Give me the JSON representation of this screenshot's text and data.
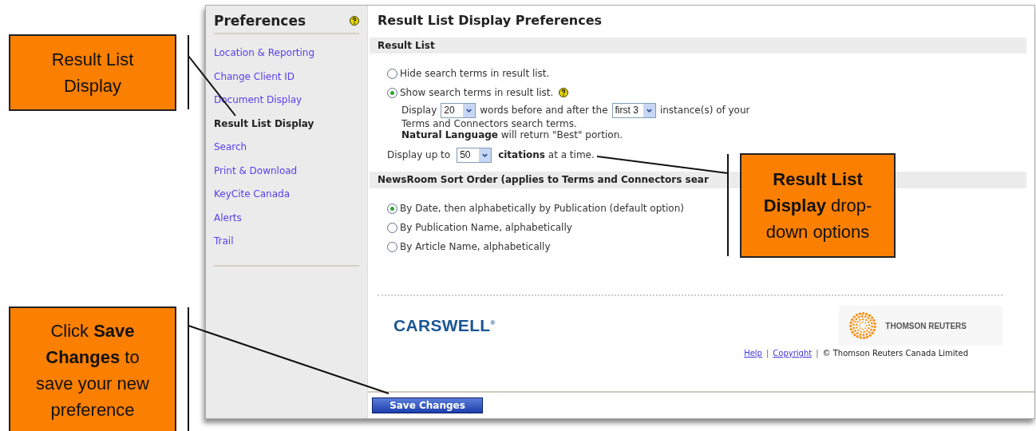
{
  "sidebar": {
    "title": "Preferences",
    "help": true,
    "items": [
      {
        "label": "Location & Reporting",
        "selected": false
      },
      {
        "label": "Change Client ID",
        "selected": false
      },
      {
        "label": "Document Display",
        "selected": false
      },
      {
        "label": "Result List Display",
        "selected": true
      },
      {
        "label": "Search",
        "selected": false
      },
      {
        "label": "Print & Download",
        "selected": false
      },
      {
        "label": "KeyCite Canada",
        "selected": false
      },
      {
        "label": "Alerts",
        "selected": false
      },
      {
        "label": "Trail",
        "selected": false
      }
    ]
  },
  "main": {
    "title": "Result List Display Preferences",
    "result_list": {
      "heading": "Result List",
      "options": [
        {
          "label": "Hide search terms in result list.",
          "selected": false,
          "help": false
        },
        {
          "label": "Show search terms in result list.",
          "selected": true,
          "help": true
        }
      ],
      "words_row": [
        {
          "kind": "text",
          "text": "Display"
        },
        {
          "kind": "select",
          "value": "20"
        },
        {
          "kind": "text",
          "text": "words before and after the"
        },
        {
          "kind": "select",
          "value": "first 3"
        },
        {
          "kind": "text",
          "text": "instance(s) of your"
        }
      ],
      "notes": [
        "Terms and Connectors search terms.",
        "**Natural Language** will return \"Best\" portion."
      ],
      "citations_row": [
        {
          "kind": "text",
          "text": "Display up to"
        },
        {
          "kind": "select",
          "value": "50"
        },
        {
          "kind": "text",
          "text": "**citations** at a time."
        }
      ]
    },
    "sort_order": {
      "heading": "NewsRoom Sort Order (applies to Terms and Connectors sear",
      "options": [
        {
          "label": "By Date, then alphabetically by Publication (default option)",
          "selected": true
        },
        {
          "label": "By Publication Name, alphabetically",
          "selected": false
        },
        {
          "label": "By Article Name, alphabetically",
          "selected": false
        }
      ]
    },
    "logos": {
      "left": "CARSWELL$^{®}$",
      "right": "THOMSON REUTERS"
    },
    "footer": [
      {
        "kind": "link",
        "text": "Help"
      },
      {
        "kind": "sep",
        "text": "|"
      },
      {
        "kind": "link",
        "text": "Copyright"
      },
      {
        "kind": "sep",
        "text": "|"
      },
      {
        "kind": "text",
        "text": "© Thomson Reuters Canada Limited"
      }
    ],
    "save_button": "Save Changes"
  },
  "callouts": {
    "sidebar_note": "Result List Display",
    "dropdown_note": "**Result List Display** drop-down options",
    "save_note": "Click **Save Changes** to save your new preference"
  }
}
